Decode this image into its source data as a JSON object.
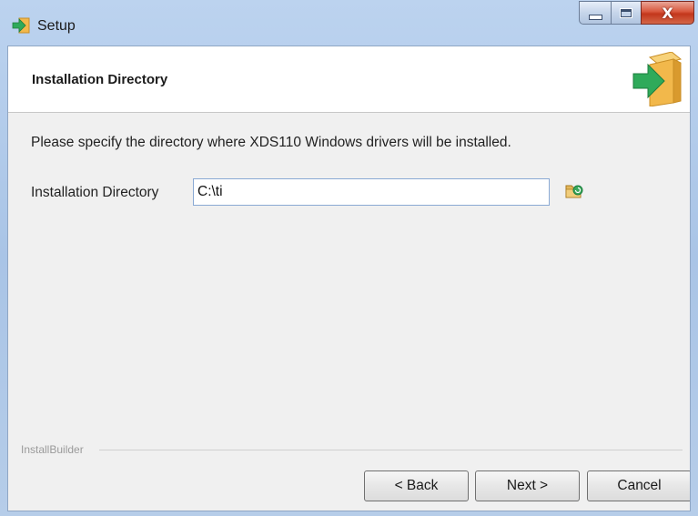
{
  "window": {
    "title": "Setup",
    "controls": {
      "minimize": "minimize",
      "maximize": "maximize",
      "close": "X"
    }
  },
  "header": {
    "title": "Installation Directory"
  },
  "main": {
    "description": "Please specify the directory where XDS110 Windows drivers will be installed.",
    "directory_label": "Installation Directory",
    "directory_value": "C:\\ti"
  },
  "footer": {
    "brand": "InstallBuilder",
    "back_label": "< Back",
    "next_label": "Next >",
    "cancel_label": "Cancel"
  },
  "icons": {
    "app": "setup-arrow-icon",
    "header": "box-arrow-icon",
    "browse": "folder-browse-icon"
  },
  "colors": {
    "accent_green": "#2faa5a",
    "box_orange": "#f2b84b",
    "close_red": "#c3361c"
  }
}
